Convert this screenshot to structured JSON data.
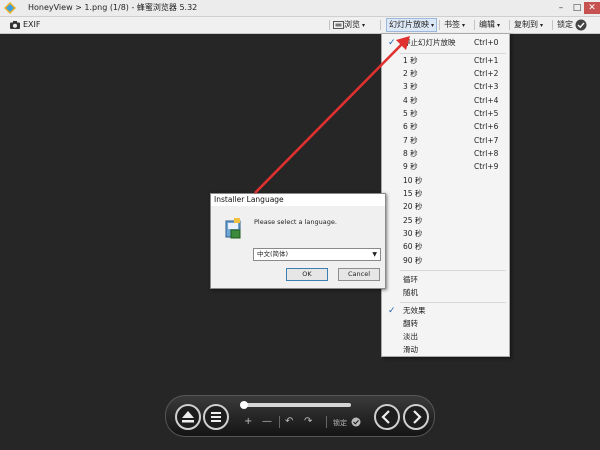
{
  "window": {
    "title": "HoneyView > 1.png (1/8) - 蜂蜜浏览器 5.32",
    "min": "–",
    "max": "□",
    "close": "✕"
  },
  "toolbar": {
    "exif": "EXIF",
    "browse": "浏览",
    "slideshow": "幻灯片放映",
    "bookmark": "书签",
    "edit": "编辑",
    "copyto": "复制到",
    "lock": "锁定",
    "arrow": "▾"
  },
  "slideshow_menu": {
    "stop": {
      "label": "停止幻灯片放映",
      "shortcut": "Ctrl+0",
      "checked": true
    },
    "intervals": [
      {
        "label": "1 秒",
        "shortcut": "Ctrl+1"
      },
      {
        "label": "2 秒",
        "shortcut": "Ctrl+2"
      },
      {
        "label": "3 秒",
        "shortcut": "Ctrl+3"
      },
      {
        "label": "4 秒",
        "shortcut": "Ctrl+4"
      },
      {
        "label": "5 秒",
        "shortcut": "Ctrl+5"
      },
      {
        "label": "6 秒",
        "shortcut": "Ctrl+6"
      },
      {
        "label": "7 秒",
        "shortcut": "Ctrl+7"
      },
      {
        "label": "8 秒",
        "shortcut": "Ctrl+8"
      },
      {
        "label": "9 秒",
        "shortcut": "Ctrl+9"
      },
      {
        "label": "10 秒"
      },
      {
        "label": "15 秒"
      },
      {
        "label": "20 秒"
      },
      {
        "label": "25 秒"
      },
      {
        "label": "30 秒"
      },
      {
        "label": "60 秒"
      },
      {
        "label": "90 秒"
      }
    ],
    "modes": [
      {
        "label": "循环"
      },
      {
        "label": "随机"
      }
    ],
    "effects": [
      {
        "label": "无效果",
        "checked": true
      },
      {
        "label": "翻转"
      },
      {
        "label": "淡出"
      },
      {
        "label": "滑动"
      }
    ]
  },
  "installer_dialog": {
    "title": "Installer Language",
    "prompt": "Please select a language.",
    "selected_language": "中文(简体)",
    "ok": "OK",
    "cancel": "Cancel"
  },
  "controller": {
    "lock_label": "锁定",
    "zoom_in": "+",
    "zoom_out": "—",
    "rotate_left": "↶",
    "rotate_right": "↷",
    "progress": 0
  },
  "colors": {
    "background": "#262626",
    "arrow": "#e03030",
    "accent": "#1a5fb4"
  }
}
